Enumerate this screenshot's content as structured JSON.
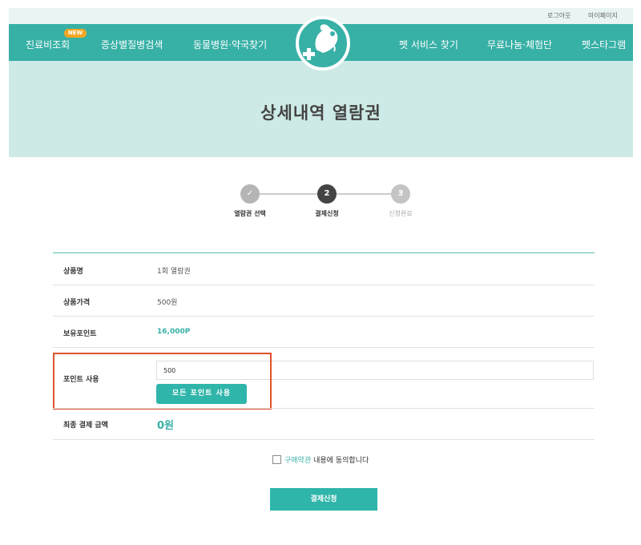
{
  "header": {
    "top_links": {
      "logout": "로그아웃",
      "mypage": "마이페이지"
    },
    "nav": {
      "item1": "진료비조회",
      "new_badge": "NEW",
      "item2": "증상별질병검색",
      "item3": "동물병원·약국찾기",
      "item4": "펫 서비스 찾기",
      "item5": "무료나눔·체험단",
      "item6": "펫스타그램"
    }
  },
  "hero": {
    "title": "상세내역 열람권"
  },
  "stepper": {
    "steps": [
      {
        "number": "✓",
        "label": "열람권 선택"
      },
      {
        "number": "2",
        "label": "결제신청"
      },
      {
        "number": "3",
        "label": "신청완료"
      }
    ]
  },
  "form": {
    "product_name": {
      "label": "상품명",
      "value": "1회 열람권"
    },
    "product_price": {
      "label": "상품가격",
      "value": "500원"
    },
    "owned_points": {
      "label": "보유포인트",
      "value": "16,000P"
    },
    "use_points": {
      "label": "포인트 사용",
      "input_value": "500",
      "use_all_label": "모든 포인트 사용"
    },
    "final_amount": {
      "label": "최종 결제 금액",
      "value": "0원"
    }
  },
  "agreement": {
    "terms_link": "구매약관",
    "text": "내용에 동의합니다",
    "checked": false
  },
  "submit": {
    "label": "결제신청"
  },
  "colors": {
    "accent": "#37b0a6",
    "hero_bg": "#cdeae6",
    "highlight": "#e0512b"
  }
}
